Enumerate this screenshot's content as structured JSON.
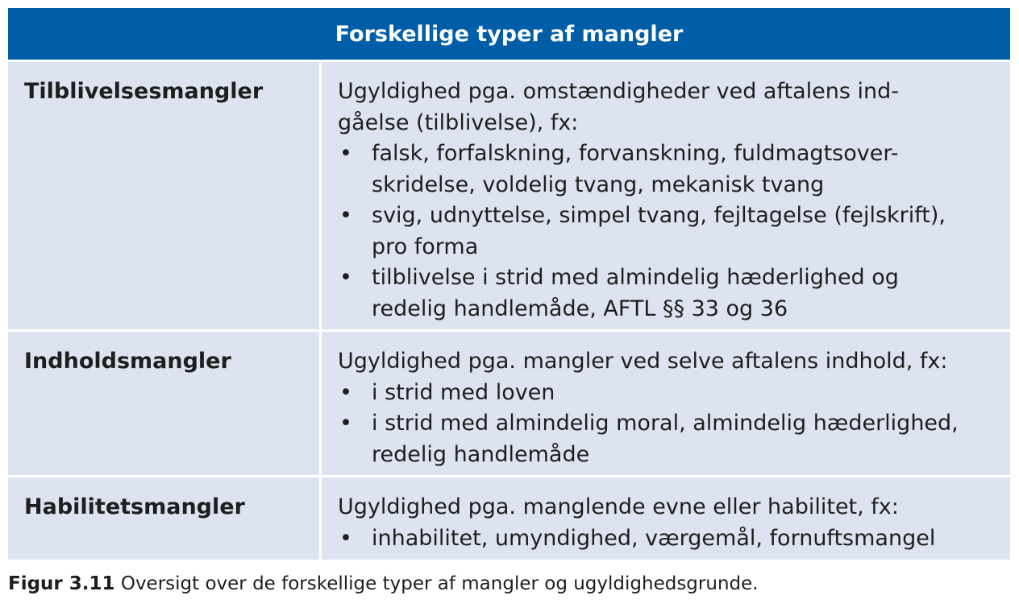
{
  "table": {
    "title": "Forskellige typer af mangler",
    "rows": [
      {
        "label": "Tilblivelsesmangler",
        "intro_line1": "Ugyldighed pga. omstændigheder ved aftalens ind-",
        "intro_line2": "gåelse (tilblivelse), fx:",
        "bullets": [
          {
            "line1": "falsk, forfalskning, forvanskning, fuldmagtsover-",
            "line2": "skridelse, voldelig tvang, mekanisk tvang"
          },
          {
            "line1": "svig, udnyttelse, simpel tvang, fejltagelse (fejlskrift),",
            "line2": "pro forma"
          },
          {
            "line1": "tilblivelse i strid med almindelig hæderlighed og",
            "line2": "redelig handlemåde, AFTL §§ 33 og 36"
          }
        ]
      },
      {
        "label": "Indholdsmangler",
        "intro_line1": "Ugyldighed pga. mangler ved selve aftalens indhold, fx:",
        "bullets": [
          {
            "line1": "i strid med loven"
          },
          {
            "line1": "i strid med almindelig moral, almindelig hæderlighed,",
            "line2": "redelig handlemåde"
          }
        ]
      },
      {
        "label": "Habilitetsmangler",
        "intro_line1": "Ugyldighed pga. manglende evne eller habilitet, fx:",
        "bullets": [
          {
            "line1": "inhabilitet, umyndighed, værgemål, fornuftsmangel"
          }
        ]
      }
    ]
  },
  "caption": {
    "label": "Figur 3.11",
    "text": " Oversigt over de forskellige typer af mangler og ugyldighedsgrunde."
  },
  "colors": {
    "header_bg": "#005ea8",
    "row_bg": "#dde3f0"
  }
}
